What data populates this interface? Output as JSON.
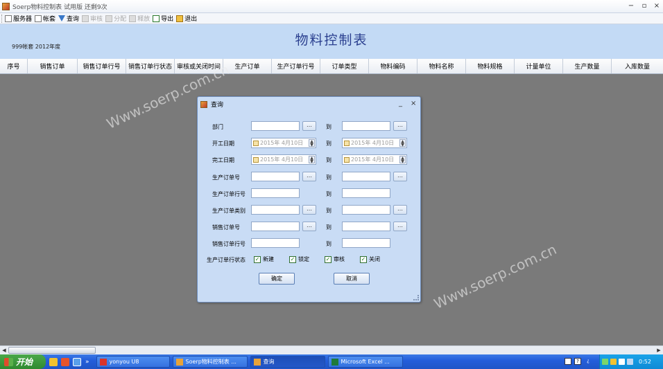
{
  "window": {
    "title": "Soerp物料控制表 试用版  还剩9次",
    "minimize": "−",
    "restore": "▫",
    "close": "×"
  },
  "toolbar": {
    "items": [
      {
        "label": "服务器",
        "icon": "server-icon",
        "enabled": true
      },
      {
        "label": "帐套",
        "icon": "document-icon",
        "enabled": true
      },
      {
        "label": "查询",
        "icon": "filter-icon",
        "enabled": true
      },
      {
        "label": "审核",
        "icon": "approve-icon",
        "enabled": false
      },
      {
        "label": "分配",
        "icon": "assign-icon",
        "enabled": false
      },
      {
        "label": "释放",
        "icon": "release-icon",
        "enabled": false
      },
      {
        "label": "导出",
        "icon": "export-icon",
        "enabled": true
      },
      {
        "label": "退出",
        "icon": "exit-icon",
        "enabled": true
      }
    ]
  },
  "header": {
    "page_title": "物料控制表",
    "set_info": "999帐套  2012年度"
  },
  "grid": {
    "columns": [
      "序号",
      "销售订单",
      "销售订单行号",
      "销售订单行状态",
      "审核或关闭时间",
      "生产订单",
      "生产订单行号",
      "订单类型",
      "物料编码",
      "物料名称",
      "物料规格",
      "计量单位",
      "生产数量",
      "入库数量"
    ]
  },
  "dialog": {
    "title": "查询",
    "minimize": "_",
    "close": "×",
    "to_label": "到",
    "dots": "…",
    "fields": {
      "department": "部门",
      "start_date": "开工日期",
      "finish_date": "完工日期",
      "prod_order_no": "生产订单号",
      "prod_order_line": "生产订单行号",
      "prod_order_type": "生产订单类别",
      "sales_order_no": "销售订单号",
      "sales_order_line": "销售订单行号",
      "line_status": "生产订单行状态"
    },
    "date_value": "2015年 4月10日",
    "statuses": [
      {
        "label": "新建",
        "checked": true
      },
      {
        "label": "锁定",
        "checked": true
      },
      {
        "label": "审核",
        "checked": true
      },
      {
        "label": "关闭",
        "checked": true
      }
    ],
    "ok": "确定",
    "cancel": "取消"
  },
  "watermark": "Www.soerp.com.cn",
  "taskbar": {
    "start": "开始",
    "quicklaunch_more": "»",
    "tasks": [
      {
        "label": "yonyou U8",
        "icon": "u8-icon"
      },
      {
        "label": "Soerp物料控制表 ...",
        "icon": "soerp-icon"
      },
      {
        "label": "查询",
        "icon": "query-icon",
        "active": true
      },
      {
        "label": "Microsoft Excel ...",
        "icon": "excel-icon"
      }
    ],
    "clock": "0:52"
  },
  "colors": {
    "accent": "#2a3f8f",
    "header_band": "#c3daf5",
    "dialog_bg": "#c9dcf5",
    "workspace": "#7a7a7a",
    "taskbar": "#245edb"
  }
}
